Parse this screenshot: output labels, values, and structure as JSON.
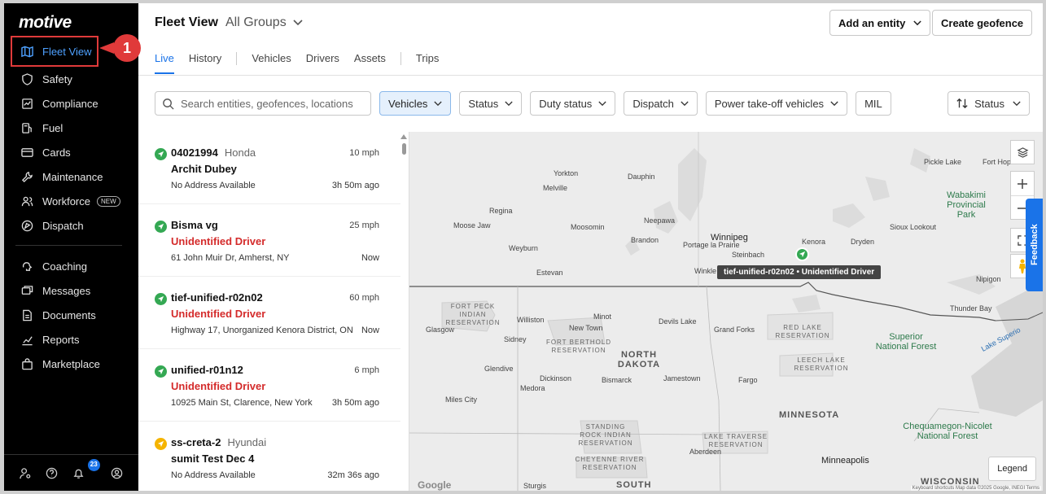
{
  "app": {
    "logo": "motive"
  },
  "sidebar": {
    "items": [
      {
        "label": "Fleet View",
        "icon": "map-icon"
      },
      {
        "label": "Safety",
        "icon": "shield-icon"
      },
      {
        "label": "Compliance",
        "icon": "compliance-icon"
      },
      {
        "label": "Fuel",
        "icon": "fuel-icon"
      },
      {
        "label": "Cards",
        "icon": "card-icon"
      },
      {
        "label": "Maintenance",
        "icon": "wrench-icon"
      },
      {
        "label": "Workforce",
        "icon": "people-icon",
        "badge": "NEW"
      },
      {
        "label": "Dispatch",
        "icon": "dispatch-icon"
      },
      {
        "label": "Coaching",
        "icon": "coaching-icon"
      },
      {
        "label": "Messages",
        "icon": "messages-icon"
      },
      {
        "label": "Documents",
        "icon": "document-icon"
      },
      {
        "label": "Reports",
        "icon": "reports-icon"
      },
      {
        "label": "Marketplace",
        "icon": "marketplace-icon"
      }
    ],
    "notification_count": "23",
    "callout_number": "1"
  },
  "header": {
    "title": "Fleet View",
    "group_selector": "All Groups",
    "add_entity": "Add an entity",
    "create_geofence": "Create geofence"
  },
  "tabs": [
    "Live",
    "History",
    "Vehicles",
    "Drivers",
    "Assets",
    "Trips"
  ],
  "filters": {
    "search_placeholder": "Search entities, geofences, locations",
    "chips": [
      "Vehicles",
      "Status",
      "Duty status",
      "Dispatch",
      "Power take-off vehicles",
      "MIL"
    ],
    "sort_label": "Status"
  },
  "vehicles": [
    {
      "id": "04021994",
      "make": "Honda",
      "speed": "10 mph",
      "driver": "Archit Dubey",
      "driver_unidentified": false,
      "address": "No Address Available",
      "ago": "3h 50m ago",
      "status_color": "#34a853"
    },
    {
      "id": "Bisma vg",
      "make": "",
      "speed": "25 mph",
      "driver": "Unidentified Driver",
      "driver_unidentified": true,
      "address": "61 John Muir Dr, Amherst, NY",
      "ago": "Now",
      "status_color": "#34a853"
    },
    {
      "id": "tief-unified-r02n02",
      "make": "",
      "speed": "60 mph",
      "driver": "Unidentified Driver",
      "driver_unidentified": true,
      "address": "Highway 17, Unorganized Kenora District, ON",
      "ago": "Now",
      "status_color": "#34a853"
    },
    {
      "id": "unified-r01n12",
      "make": "",
      "speed": "6 mph",
      "driver": "Unidentified Driver",
      "driver_unidentified": true,
      "address": "10925 Main St, Clarence, New York",
      "ago": "3h 50m ago",
      "status_color": "#34a853"
    },
    {
      "id": "ss-creta-2",
      "make": "Hyundai",
      "speed": "",
      "driver": "sumit Test Dec 4",
      "driver_unidentified": false,
      "address": "No Address Available",
      "ago": "32m 36s ago",
      "status_color": "#f5b400"
    }
  ],
  "map": {
    "tooltip": "tief-unified-r02n02 • Unidentified Driver",
    "legend": "Legend",
    "feedback": "Feedback",
    "google": "Google",
    "attribution": "Keyboard shortcuts   Map data ©2025 Google, INEGI   Terms",
    "labels": {
      "yorkton": "Yorkton",
      "dauphin": "Dauphin",
      "melville": "Melville",
      "regina": "Regina",
      "moose_jaw": "Moose Jaw",
      "moosomin": "Moosomin",
      "neepawa": "Neepawa",
      "brandon": "Brandon",
      "portage": "Portage\nla Prairie",
      "winnipeg": "Winnipeg",
      "steinbach": "Steinbach",
      "winkler": "Winkle",
      "weyburn": "Weyburn",
      "estevan": "Estevan",
      "kenora": "Kenora",
      "dryden": "Dryden",
      "sioux_lookout": "Sioux Lookout",
      "pickle_lake": "Pickle Lake",
      "fort_hope": "Fort Hop",
      "wabakimi": "Wabakimi\nProvincial\nPark",
      "nipigon": "Nipigon",
      "thunder_bay": "Thunder Bay",
      "fort_peck": "FORT PECK\nINDIAN\nRESERVATION",
      "glasgow": "Glasgow",
      "williston": "Williston",
      "minot": "Minot",
      "new_town": "New Town",
      "devils_lake": "Devils Lake",
      "grand_forks": "Grand Forks",
      "red_lake": "RED LAKE\nRESERVATION",
      "sidney": "Sidney",
      "fort_berthold": "FORT BERTHOLD\nRESERVATION",
      "north_dakota": "NORTH\nDAKOTA",
      "leech_lake": "LEECH LAKE\nRESERVATION",
      "superior": "Superior\nNational Forest",
      "lake_superior": "Lake Superio",
      "glendive": "Glendive",
      "dickinson": "Dickinson",
      "bismarck": "Bismarck",
      "jamestown": "Jamestown",
      "fargo": "Fargo",
      "medora": "Medora",
      "miles_city": "Miles City",
      "minnesota": "MINNESOTA",
      "chequamegon": "Chequamegon-Nicolet\nNational Forest",
      "standing_rock": "STANDING\nROCK INDIAN\nRESERVATION",
      "lake_traverse": "LAKE TRAVERSE\nRESERVATION",
      "minneapolis": "Minneapolis",
      "cheyenne_river": "CHEYENNE RIVER\nRESERVATION",
      "aberdeen": "Aberdeen",
      "wisconsin": "WISCONSIN",
      "south": "SOUTH",
      "sturgis": "Sturgis"
    }
  }
}
